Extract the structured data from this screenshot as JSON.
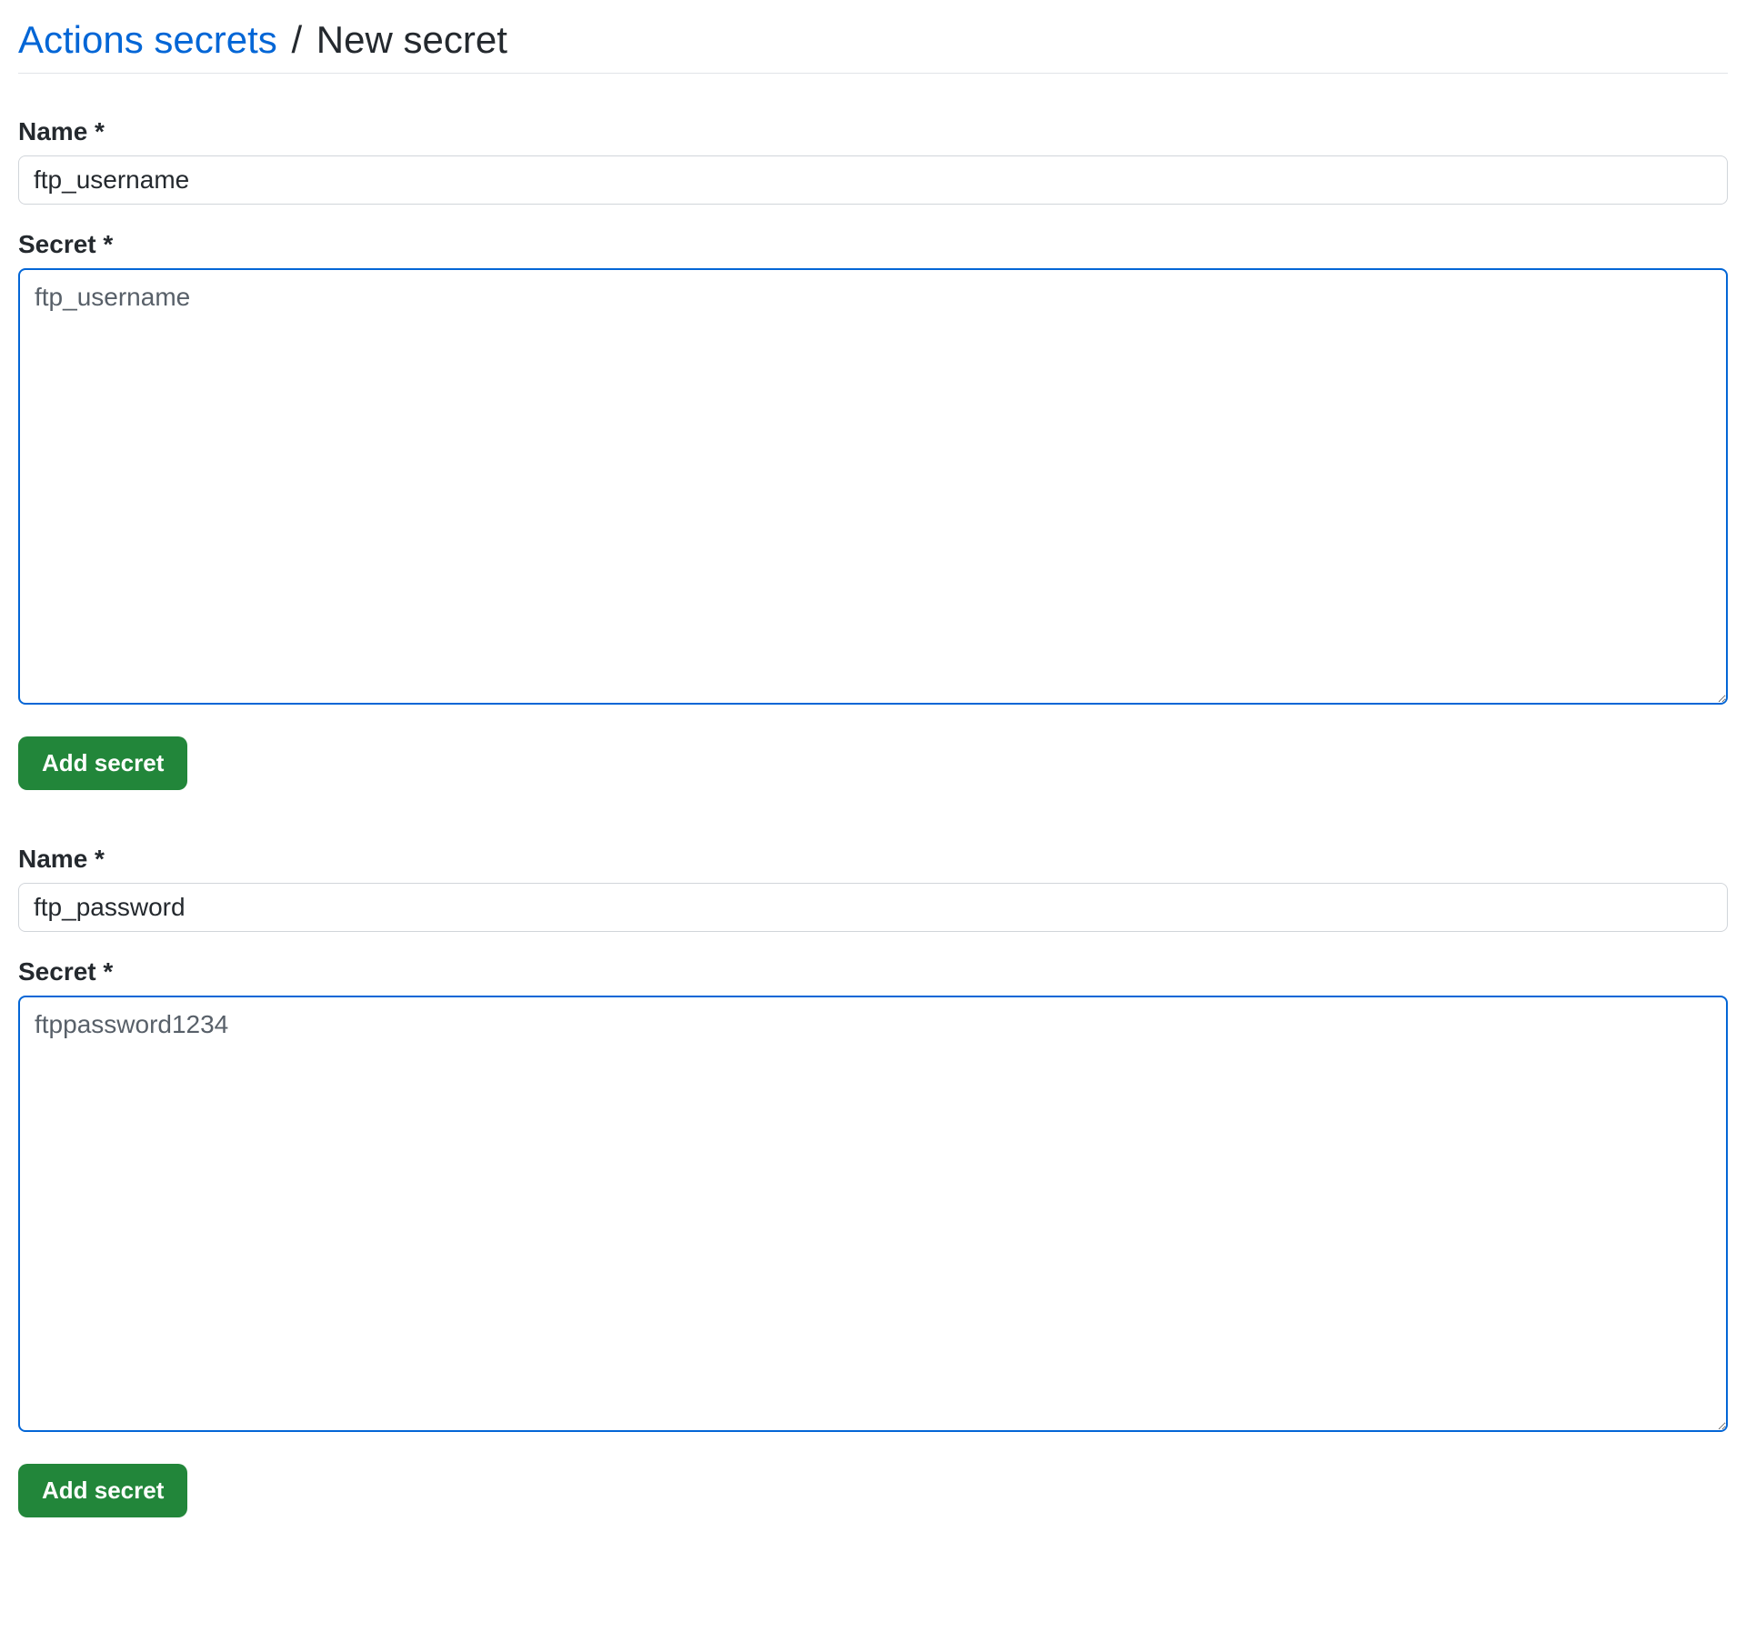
{
  "header": {
    "breadcrumb_link": "Actions secrets",
    "separator": "/",
    "current": "New secret"
  },
  "forms": [
    {
      "name_label": "Name *",
      "name_value": "ftp_username",
      "secret_label": "Secret *",
      "secret_value": "ftp_username",
      "button_label": "Add secret"
    },
    {
      "name_label": "Name *",
      "name_value": "ftp_password",
      "secret_label": "Secret *",
      "secret_value": "ftppassword1234",
      "button_label": "Add secret"
    }
  ]
}
